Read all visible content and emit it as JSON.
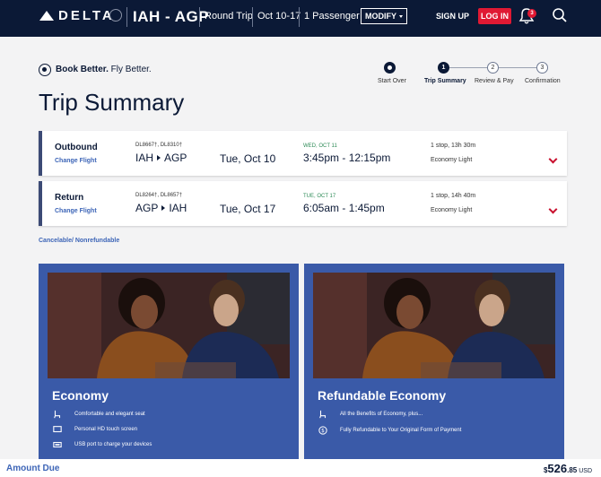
{
  "header": {
    "logo_text": "DELTA",
    "route": "IAH - AGP",
    "trip_type": "Round Trip",
    "dates": "Oct 10-17",
    "passengers": "1 Passenger",
    "modify_label": "MODIFY",
    "signup_label": "SIGN UP",
    "login_label": "LOG IN",
    "notification_count": "3"
  },
  "tagline": {
    "bold": "Book Better.",
    "rest": " Fly Better."
  },
  "stepper": {
    "steps": [
      {
        "number": "",
        "label": "Start Over",
        "state": "done"
      },
      {
        "number": "1",
        "label": "Trip Summary",
        "state": "active"
      },
      {
        "number": "2",
        "label": "Review & Pay",
        "state": "pending"
      },
      {
        "number": "3",
        "label": "Confirmation",
        "state": "pending"
      }
    ]
  },
  "page_title": "Trip Summary",
  "flights": [
    {
      "type": "Outbound",
      "change_label": "Change Flight",
      "flight_numbers": "DL8667†, DL8310†",
      "origin": "IAH",
      "destination": "AGP",
      "date": "Tue, Oct 10",
      "arrival_day": "WED, OCT 11",
      "times": "3:45pm - 12:15pm",
      "stops": "1 stop, 13h 30m",
      "fare_class": "Economy Light"
    },
    {
      "type": "Return",
      "change_label": "Change Flight",
      "flight_numbers": "DL8264†, DL8657†",
      "origin": "AGP",
      "destination": "IAH",
      "date": "Tue, Oct 17",
      "arrival_day": "TUE, OCT 17",
      "times": "6:05am - 1:45pm",
      "stops": "1 stop, 14h 40m",
      "fare_class": "Economy Light"
    }
  ],
  "policy_text": "Cancelable/ Nonrefundable",
  "fares": [
    {
      "name": "Economy",
      "features": [
        {
          "icon": "seat-icon",
          "text": "Comfortable and elegant seat"
        },
        {
          "icon": "screen-icon",
          "text": "Personal HD touch screen"
        },
        {
          "icon": "usb-icon",
          "text": "USB port to charge your devices"
        }
      ]
    },
    {
      "name": "Refundable Economy",
      "features": [
        {
          "icon": "seat-icon",
          "text": "All the Benefits of Economy, plus..."
        },
        {
          "icon": "dollar-icon",
          "text": "Fully Refundable to Your Original Form of Payment"
        }
      ]
    }
  ],
  "amount": {
    "label": "Amount Due",
    "currency_symbol": "$",
    "whole": "526",
    "cents": ".85",
    "currency": "USD"
  },
  "colors": {
    "header_bg": "#0b1936",
    "login_red": "#e01933",
    "link_blue": "#3d65b7",
    "fare_card_bg": "#3a5aa8",
    "arrival_green": "#2e8b57"
  }
}
